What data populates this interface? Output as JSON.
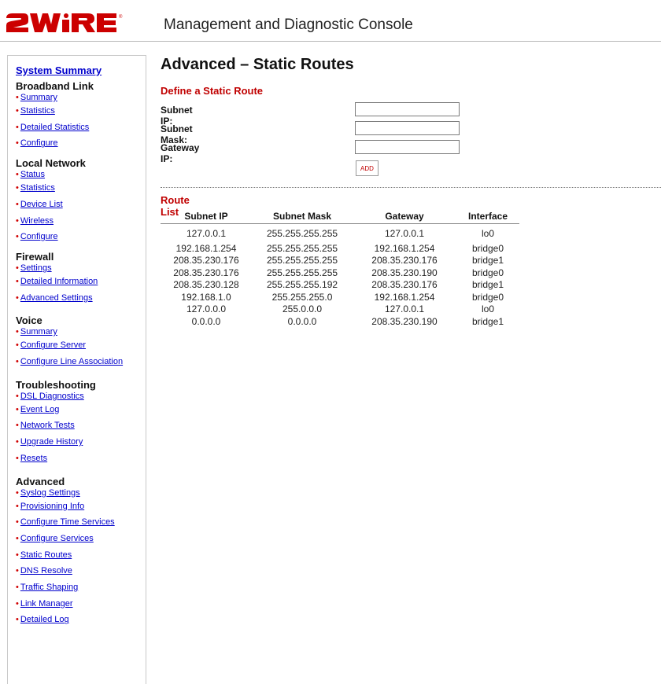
{
  "header": {
    "logo_text": "2WIRE",
    "console_title": "Management and Diagnostic Console",
    "brand_color": "#cc0000"
  },
  "sidebar": {
    "summary_link": "System Summary",
    "sections": [
      {
        "title": "Broadband Link",
        "items": [
          "Summary",
          "Statistics",
          "Detailed Statistics",
          "Configure"
        ]
      },
      {
        "title": "Local Network",
        "items": [
          "Status",
          "Statistics",
          "Device List",
          "Wireless",
          "Configure"
        ]
      },
      {
        "title": "Firewall",
        "items": [
          "Settings",
          "Detailed Information",
          "Advanced Settings"
        ]
      },
      {
        "title": "Voice",
        "items": [
          "Summary",
          "Configure Server",
          "Configure Line Association"
        ]
      },
      {
        "title": "Troubleshooting",
        "items": [
          "DSL Diagnostics",
          "Event Log",
          "Network Tests",
          "Upgrade History",
          "Resets"
        ]
      },
      {
        "title": "Advanced",
        "items": [
          "Syslog Settings",
          "Provisioning Info",
          "Configure Time Services",
          "Configure Services",
          "Static Routes",
          "DNS Resolve",
          "Traffic Shaping",
          "Link Manager",
          "Detailed Log"
        ]
      }
    ]
  },
  "main": {
    "page_title": "Advanced – Static Routes",
    "define_title": "Define a Static Route",
    "form": {
      "subnet_ip_label": "Subnet IP:",
      "subnet_ip_value": "",
      "subnet_mask_label": "Subnet Mask:",
      "subnet_mask_value": "",
      "gateway_ip_label": "Gateway IP:",
      "gateway_ip_value": "",
      "add_label": "ADD"
    },
    "route_list_title": "Route List",
    "columns": [
      "Subnet IP",
      "Subnet Mask",
      "Gateway",
      "Interface"
    ],
    "rows": [
      [
        "127.0.0.1",
        "255.255.255.255",
        "127.0.0.1",
        "lo0"
      ],
      [
        "192.168.1.254",
        "255.255.255.255",
        "192.168.1.254",
        "bridge0"
      ],
      [
        "208.35.230.176",
        "255.255.255.255",
        "208.35.230.176",
        "bridge1"
      ],
      [
        "208.35.230.176",
        "255.255.255.255",
        "208.35.230.190",
        "bridge0"
      ],
      [
        "208.35.230.128",
        "255.255.255.192",
        "208.35.230.176",
        "bridge1"
      ],
      [
        "192.168.1.0",
        "255.255.255.0",
        "192.168.1.254",
        "bridge0"
      ],
      [
        "127.0.0.0",
        "255.0.0.0",
        "127.0.0.1",
        "lo0"
      ],
      [
        "0.0.0.0",
        "0.0.0.0",
        "208.35.230.190",
        "bridge1"
      ]
    ]
  }
}
